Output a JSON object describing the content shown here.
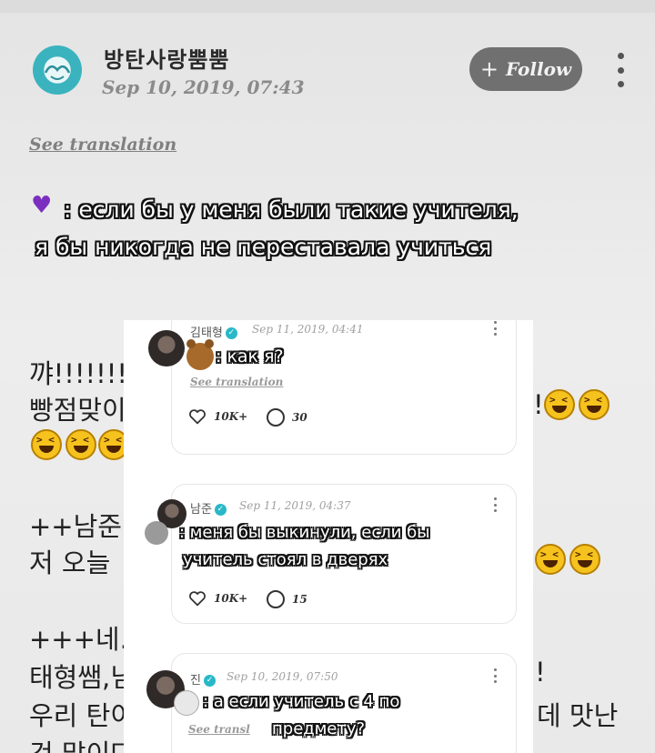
{
  "post": {
    "username": "방탄사랑뿜뿜",
    "date": "Sep 10, 2019, 07:43",
    "follow_label": "Follow",
    "see_translation": "See translation",
    "caption_line1": ": если бы у меня были такие учителя,",
    "caption_line2": "я бы никогда не переставала учиться",
    "ghost_text_1": "?",
    "ghost_text_2": "~",
    "body_lines": [
      "꺄!!!!!!!스",
      "빵점맞이",
      "++남준님",
      "저 오늘",
      "+++네..간",
      "태형쌤,님",
      "우리 탄이",
      "것 많이다"
    ],
    "body_right": {
      "line2_end": "!",
      "line6_end": "!",
      "line7_end": "데 맛난"
    }
  },
  "comments": [
    {
      "author": "김태형",
      "date": "Sep 11, 2019, 04:41",
      "caption": ": как я?",
      "see_translation": "See translation",
      "likes": "10K+",
      "replies": "30"
    },
    {
      "author": "남준",
      "date": "Sep 11, 2019, 04:37",
      "caption_line1": ": меня бы выкинули, если бы",
      "caption_line2": "учитель стоял в дверях",
      "likes": "10K+",
      "replies": "15"
    },
    {
      "author": "진",
      "date": "Sep 10, 2019, 07:50",
      "caption_line1": ": а если учитель с 4 по",
      "caption_line2": "предмету?",
      "see_translation": "See transl"
    }
  ],
  "colors": {
    "accent_verified": "#28b8c8",
    "follow_bg": "#707070",
    "emoji_heart": "#7b2fbf"
  }
}
